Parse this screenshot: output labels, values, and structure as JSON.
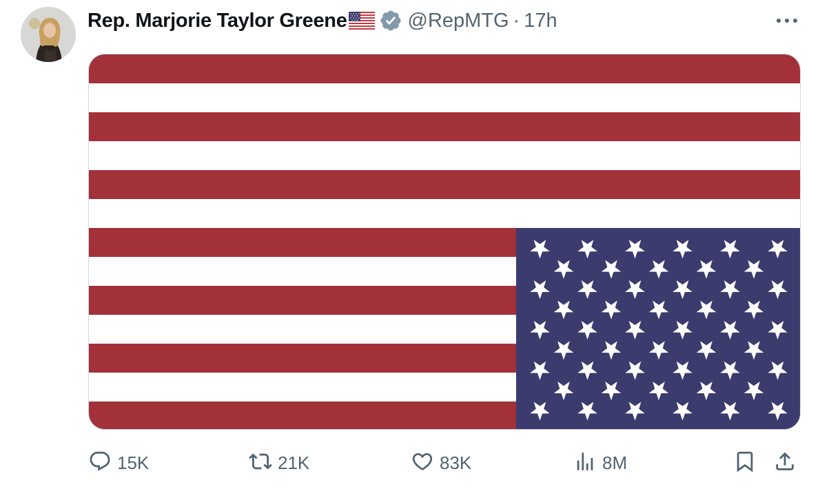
{
  "tweet": {
    "author": {
      "display_name": "Rep. Marjorie Taylor Greene",
      "name_emoji": "us-flag-emoji",
      "verified_icon": "verified-badge-icon",
      "handle": "@RepMTG",
      "separator": "·",
      "time": "17h"
    },
    "more_icon": "more-horizontal-icon",
    "media": {
      "description_icon": "us-flag-upside-down",
      "colors": {
        "red": "#a3313a",
        "white": "#ffffff",
        "blue": "#3c3b6e"
      }
    },
    "actions": {
      "reply": {
        "icon": "reply-icon",
        "count": "15K"
      },
      "repost": {
        "icon": "repost-icon",
        "count": "21K"
      },
      "like": {
        "icon": "heart-icon",
        "count": "83K"
      },
      "views": {
        "icon": "views-chart-icon",
        "count": "8M"
      },
      "bookmark": {
        "icon": "bookmark-icon"
      },
      "share": {
        "icon": "share-icon"
      }
    }
  }
}
